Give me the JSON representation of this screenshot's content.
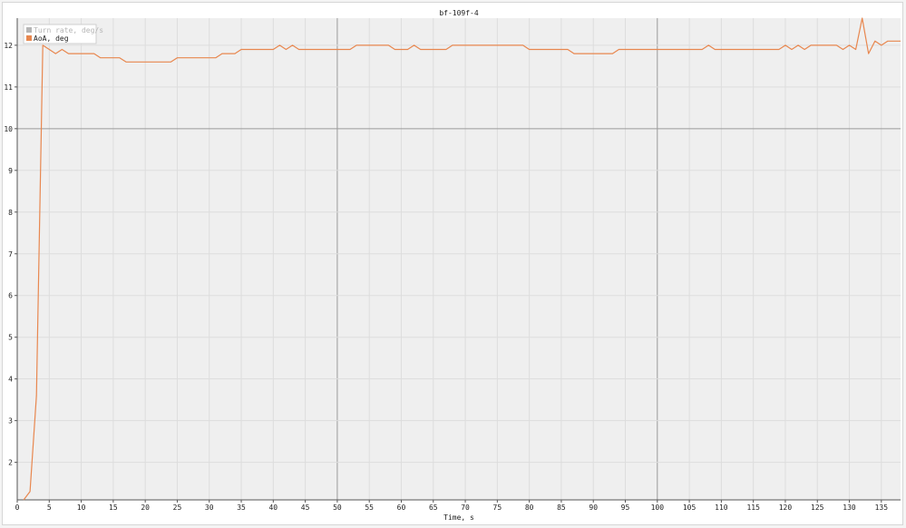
{
  "chart_data": {
    "type": "line",
    "title": "bf-109f-4",
    "xlabel": "Time, s",
    "ylabel": "",
    "xlim": [
      0,
      138
    ],
    "ylim": [
      1.1,
      12.65
    ],
    "x_ticks": [
      0,
      5,
      10,
      15,
      20,
      25,
      30,
      35,
      40,
      45,
      50,
      55,
      60,
      65,
      70,
      75,
      80,
      85,
      90,
      95,
      100,
      105,
      110,
      115,
      120,
      125,
      130,
      135
    ],
    "y_ticks": [
      2,
      3,
      4,
      5,
      6,
      7,
      8,
      9,
      10,
      11,
      12
    ],
    "grid": true,
    "legend_position": "top-left",
    "colors": {
      "plot_background": "#efefef",
      "grid_minor": "#dddddd",
      "grid_major": "#9a9a9a",
      "axis": "#555555"
    },
    "series": [
      {
        "name": "Turn rate, deg/s",
        "color": "#b5b5b5",
        "hidden": true,
        "values": []
      },
      {
        "name": "AoA, deg",
        "color": "#e8874f",
        "hidden": false,
        "points": [
          [
            1,
            1.1
          ],
          [
            2,
            1.3
          ],
          [
            3,
            3.6
          ],
          [
            4,
            12.0
          ],
          [
            5,
            11.9
          ],
          [
            6,
            11.8
          ],
          [
            7,
            11.9
          ],
          [
            8,
            11.8
          ],
          [
            9,
            11.8
          ],
          [
            10,
            11.8
          ],
          [
            11,
            11.8
          ],
          [
            12,
            11.8
          ],
          [
            13,
            11.7
          ],
          [
            14,
            11.7
          ],
          [
            15,
            11.7
          ],
          [
            16,
            11.7
          ],
          [
            17,
            11.6
          ],
          [
            18,
            11.6
          ],
          [
            19,
            11.6
          ],
          [
            20,
            11.6
          ],
          [
            21,
            11.6
          ],
          [
            22,
            11.6
          ],
          [
            23,
            11.6
          ],
          [
            24,
            11.6
          ],
          [
            25,
            11.7
          ],
          [
            26,
            11.7
          ],
          [
            27,
            11.7
          ],
          [
            28,
            11.7
          ],
          [
            29,
            11.7
          ],
          [
            30,
            11.7
          ],
          [
            31,
            11.7
          ],
          [
            32,
            11.8
          ],
          [
            33,
            11.8
          ],
          [
            34,
            11.8
          ],
          [
            35,
            11.9
          ],
          [
            36,
            11.9
          ],
          [
            37,
            11.9
          ],
          [
            38,
            11.9
          ],
          [
            39,
            11.9
          ],
          [
            40,
            11.9
          ],
          [
            41,
            12.0
          ],
          [
            42,
            11.9
          ],
          [
            43,
            12.0
          ],
          [
            44,
            11.9
          ],
          [
            45,
            11.9
          ],
          [
            46,
            11.9
          ],
          [
            47,
            11.9
          ],
          [
            48,
            11.9
          ],
          [
            49,
            11.9
          ],
          [
            50,
            11.9
          ],
          [
            51,
            11.9
          ],
          [
            52,
            11.9
          ],
          [
            53,
            12.0
          ],
          [
            54,
            12.0
          ],
          [
            55,
            12.0
          ],
          [
            56,
            12.0
          ],
          [
            57,
            12.0
          ],
          [
            58,
            12.0
          ],
          [
            59,
            11.9
          ],
          [
            60,
            11.9
          ],
          [
            61,
            11.9
          ],
          [
            62,
            12.0
          ],
          [
            63,
            11.9
          ],
          [
            64,
            11.9
          ],
          [
            65,
            11.9
          ],
          [
            66,
            11.9
          ],
          [
            67,
            11.9
          ],
          [
            68,
            12.0
          ],
          [
            69,
            12.0
          ],
          [
            70,
            12.0
          ],
          [
            71,
            12.0
          ],
          [
            72,
            12.0
          ],
          [
            73,
            12.0
          ],
          [
            74,
            12.0
          ],
          [
            75,
            12.0
          ],
          [
            76,
            12.0
          ],
          [
            77,
            12.0
          ],
          [
            78,
            12.0
          ],
          [
            79,
            12.0
          ],
          [
            80,
            11.9
          ],
          [
            81,
            11.9
          ],
          [
            82,
            11.9
          ],
          [
            83,
            11.9
          ],
          [
            84,
            11.9
          ],
          [
            85,
            11.9
          ],
          [
            86,
            11.9
          ],
          [
            87,
            11.8
          ],
          [
            88,
            11.8
          ],
          [
            89,
            11.8
          ],
          [
            90,
            11.8
          ],
          [
            91,
            11.8
          ],
          [
            92,
            11.8
          ],
          [
            93,
            11.8
          ],
          [
            94,
            11.9
          ],
          [
            95,
            11.9
          ],
          [
            96,
            11.9
          ],
          [
            97,
            11.9
          ],
          [
            98,
            11.9
          ],
          [
            99,
            11.9
          ],
          [
            100,
            11.9
          ],
          [
            101,
            11.9
          ],
          [
            102,
            11.9
          ],
          [
            103,
            11.9
          ],
          [
            104,
            11.9
          ],
          [
            105,
            11.9
          ],
          [
            106,
            11.9
          ],
          [
            107,
            11.9
          ],
          [
            108,
            12.0
          ],
          [
            109,
            11.9
          ],
          [
            110,
            11.9
          ],
          [
            111,
            11.9
          ],
          [
            112,
            11.9
          ],
          [
            113,
            11.9
          ],
          [
            114,
            11.9
          ],
          [
            115,
            11.9
          ],
          [
            116,
            11.9
          ],
          [
            117,
            11.9
          ],
          [
            118,
            11.9
          ],
          [
            119,
            11.9
          ],
          [
            120,
            12.0
          ],
          [
            121,
            11.9
          ],
          [
            122,
            12.0
          ],
          [
            123,
            11.9
          ],
          [
            124,
            12.0
          ],
          [
            125,
            12.0
          ],
          [
            126,
            12.0
          ],
          [
            127,
            12.0
          ],
          [
            128,
            12.0
          ],
          [
            129,
            11.9
          ],
          [
            130,
            12.0
          ],
          [
            131,
            11.9
          ],
          [
            132,
            12.65
          ],
          [
            133,
            11.8
          ],
          [
            134,
            12.1
          ],
          [
            135,
            12.0
          ],
          [
            136,
            12.1
          ],
          [
            137,
            12.1
          ],
          [
            138,
            12.1
          ]
        ]
      }
    ]
  }
}
